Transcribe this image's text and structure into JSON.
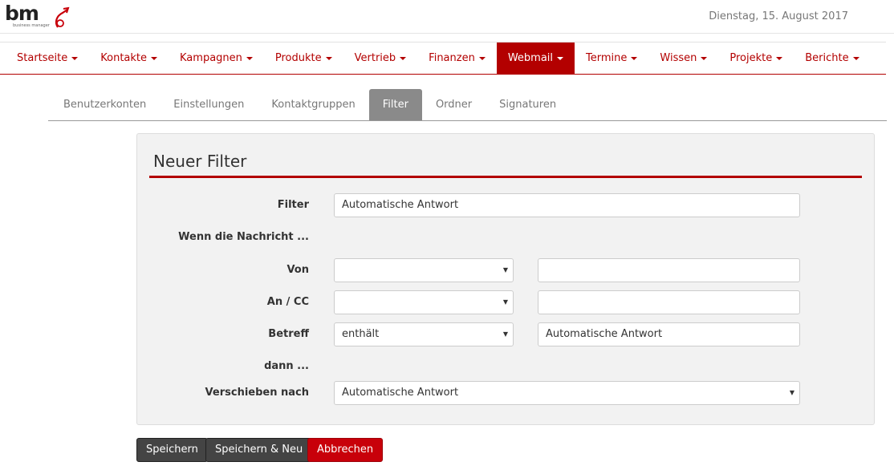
{
  "header": {
    "logo_text": "bm",
    "logo_subtext": "business manager",
    "date": "Dienstag, 15. August 2017"
  },
  "nav": {
    "items": [
      {
        "label": "Startseite"
      },
      {
        "label": "Kontakte"
      },
      {
        "label": "Kampagnen"
      },
      {
        "label": "Produkte"
      },
      {
        "label": "Vertrieb"
      },
      {
        "label": "Finanzen"
      },
      {
        "label": "Webmail"
      },
      {
        "label": "Termine"
      },
      {
        "label": "Wissen"
      },
      {
        "label": "Projekte"
      },
      {
        "label": "Berichte"
      }
    ],
    "active": "Webmail"
  },
  "subtabs": {
    "items": [
      {
        "label": "Benutzerkonten"
      },
      {
        "label": "Einstellungen"
      },
      {
        "label": "Kontaktgruppen"
      },
      {
        "label": "Filter"
      },
      {
        "label": "Ordner"
      },
      {
        "label": "Signaturen"
      }
    ],
    "active": "Filter"
  },
  "form": {
    "title": "Neuer Filter",
    "filter_label": "Filter",
    "filter_value": "Automatische Antwort",
    "condition_heading": "Wenn die Nachricht ...",
    "from_label": "Von",
    "from_operator": "",
    "from_value": "",
    "to_label": "An / CC",
    "to_operator": "",
    "to_value": "",
    "subject_label": "Betreff",
    "subject_operator": "enthält",
    "subject_value": "Automatische Antwort",
    "action_heading": "dann ...",
    "move_label": "Verschieben nach",
    "move_value": "Automatische Antwort"
  },
  "buttons": {
    "save": "Speichern",
    "save_new": "Speichern & Neu",
    "cancel": "Abbrechen"
  },
  "colors": {
    "accent": "#b30000",
    "active_tab": "#8a8a8a",
    "button_dark": "#444444",
    "button_cancel": "#c8000a"
  }
}
